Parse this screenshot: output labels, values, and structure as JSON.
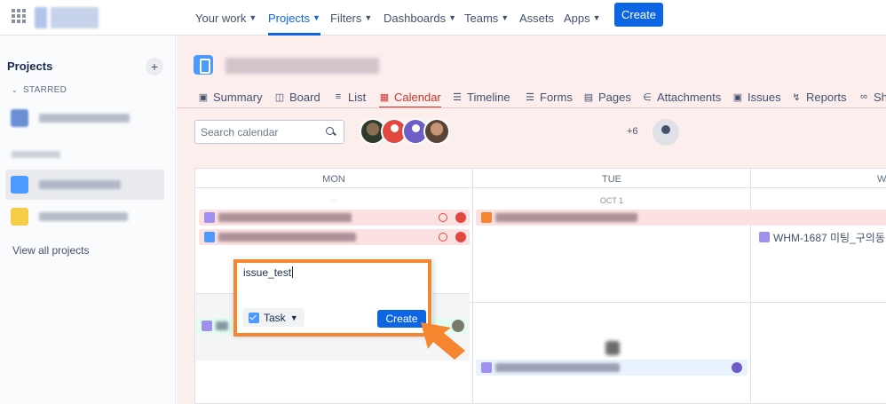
{
  "topnav": {
    "items": [
      {
        "label": "Your work",
        "chevron": true
      },
      {
        "label": "Projects",
        "chevron": true,
        "active": true
      },
      {
        "label": "Filters",
        "chevron": true
      },
      {
        "label": "Dashboards",
        "chevron": true
      },
      {
        "label": "Teams",
        "chevron": true
      },
      {
        "label": "Assets",
        "chevron": false
      },
      {
        "label": "Apps",
        "chevron": true
      }
    ],
    "create_label": "Create"
  },
  "sidebar": {
    "title": "Projects",
    "starred_label": "STARRED",
    "view_all": "View all projects"
  },
  "tabs": [
    {
      "label": "Summary",
      "icon": "summary-icon"
    },
    {
      "label": "Board",
      "icon": "board-icon"
    },
    {
      "label": "List",
      "icon": "list-icon"
    },
    {
      "label": "Calendar",
      "icon": "calendar-icon",
      "active": true
    },
    {
      "label": "Timeline",
      "icon": "timeline-icon"
    },
    {
      "label": "Forms",
      "icon": "forms-icon"
    },
    {
      "label": "Pages",
      "icon": "pages-icon"
    },
    {
      "label": "Attachments",
      "icon": "attachment-icon"
    },
    {
      "label": "Issues",
      "icon": "issues-icon"
    },
    {
      "label": "Reports",
      "icon": "reports-icon"
    },
    {
      "label": "Sh",
      "icon": "shortcut-icon"
    }
  ],
  "calendar": {
    "search_placeholder": "Search calendar",
    "avatar_overflow": "+6",
    "days": [
      {
        "name": "MON",
        "number": ""
      },
      {
        "name": "TUE",
        "number": "OCT 1"
      },
      {
        "name": "W",
        "number": ""
      }
    ],
    "events": {
      "wed_event": "WHM-1687 미팅_구의동"
    }
  },
  "quick_create": {
    "input_value": "issue_test",
    "type_label": "Task",
    "create_label": "Create"
  },
  "colors": {
    "accent": "#0c66e4",
    "active_tab": "#c9372c",
    "highlight": "#f5862f"
  }
}
